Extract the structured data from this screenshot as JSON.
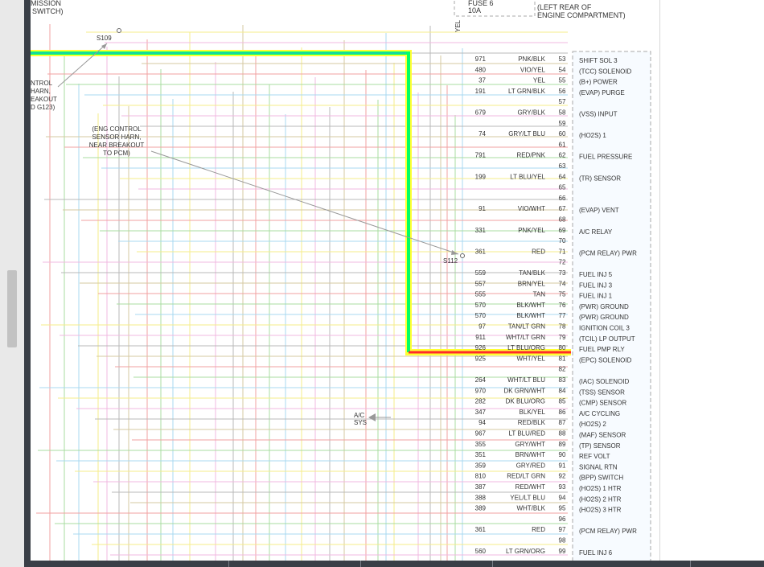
{
  "top_labels": {
    "mission": "MISSION",
    "switch": "SWITCH)",
    "fuse": "FUSE 6",
    "amps": "10A",
    "left_rear": "(LEFT REAR OF",
    "engine_comp": "ENGINE COMPARTMENT)",
    "yel": "YEL"
  },
  "splices": {
    "s109": "S109",
    "s112": "S112"
  },
  "note_left": [
    "NTROL",
    "HARN,",
    "EAKOUT",
    "D G123)"
  ],
  "note_mid": [
    "(ENG CONTROL",
    "SENSOR HARN,",
    "NEAR BREAKOUT",
    "TO PCM)"
  ],
  "ac_sys": [
    "A/C",
    "SYS"
  ],
  "pins": [
    {
      "pin": "53",
      "circuit": "971",
      "color": "PNK/BLK",
      "func": "SHIFT SOL 3"
    },
    {
      "pin": "54",
      "circuit": "480",
      "color": "VIO/YEL",
      "func": "(TCC) SOLENOID"
    },
    {
      "pin": "55",
      "circuit": "37",
      "color": "YEL",
      "func": "(B+) POWER"
    },
    {
      "pin": "56",
      "circuit": "191",
      "color": "LT GRN/BLK",
      "func": "(EVAP) PURGE"
    },
    {
      "pin": "57",
      "circuit": "",
      "color": "",
      "func": ""
    },
    {
      "pin": "58",
      "circuit": "679",
      "color": "GRY/BLK",
      "func": "(VSS) INPUT"
    },
    {
      "pin": "59",
      "circuit": "",
      "color": "",
      "func": ""
    },
    {
      "pin": "60",
      "circuit": "74",
      "color": "GRY/LT BLU",
      "func": "(HO2S) 1"
    },
    {
      "pin": "61",
      "circuit": "",
      "color": "",
      "func": ""
    },
    {
      "pin": "62",
      "circuit": "791",
      "color": "RED/PNK",
      "func": "FUEL PRESSURE"
    },
    {
      "pin": "63",
      "circuit": "",
      "color": "",
      "func": ""
    },
    {
      "pin": "64",
      "circuit": "199",
      "color": "LT BLU/YEL",
      "func": "(TR) SENSOR"
    },
    {
      "pin": "65",
      "circuit": "",
      "color": "",
      "func": ""
    },
    {
      "pin": "66",
      "circuit": "",
      "color": "",
      "func": ""
    },
    {
      "pin": "67",
      "circuit": "91",
      "color": "VIO/WHT",
      "func": "(EVAP) VENT"
    },
    {
      "pin": "68",
      "circuit": "",
      "color": "",
      "func": ""
    },
    {
      "pin": "69",
      "circuit": "331",
      "color": "PNK/YEL",
      "func": "A/C RELAY"
    },
    {
      "pin": "70",
      "circuit": "",
      "color": "",
      "func": ""
    },
    {
      "pin": "71",
      "circuit": "361",
      "color": "RED",
      "func": "(PCM RELAY) PWR"
    },
    {
      "pin": "72",
      "circuit": "",
      "color": "",
      "func": ""
    },
    {
      "pin": "73",
      "circuit": "559",
      "color": "TAN/BLK",
      "func": "FUEL INJ 5"
    },
    {
      "pin": "74",
      "circuit": "557",
      "color": "BRN/YEL",
      "func": "FUEL INJ 3"
    },
    {
      "pin": "75",
      "circuit": "555",
      "color": "TAN",
      "func": "FUEL INJ 1"
    },
    {
      "pin": "76",
      "circuit": "570",
      "color": "BLK/WHT",
      "func": "(PWR) GROUND"
    },
    {
      "pin": "77",
      "circuit": "570",
      "color": "BLK/WHT",
      "func": "(PWR) GROUND"
    },
    {
      "pin": "78",
      "circuit": "97",
      "color": "TAN/LT GRN",
      "func": "IGNITION COIL 3"
    },
    {
      "pin": "79",
      "circuit": "911",
      "color": "WHT/LT GRN",
      "func": "(TCIL) LP OUTPUT"
    },
    {
      "pin": "80",
      "circuit": "926",
      "color": "LT BLU/ORG",
      "func": "FUEL PMP RLY"
    },
    {
      "pin": "81",
      "circuit": "925",
      "color": "WHT/YEL",
      "func": "(EPC) SOLENOID"
    },
    {
      "pin": "82",
      "circuit": "",
      "color": "",
      "func": ""
    },
    {
      "pin": "83",
      "circuit": "264",
      "color": "WHT/LT BLU",
      "func": "(IAC) SOLENOID"
    },
    {
      "pin": "84",
      "circuit": "970",
      "color": "DK GRN/WHT",
      "func": "(TSS) SENSOR"
    },
    {
      "pin": "85",
      "circuit": "282",
      "color": "DK BLU/ORG",
      "func": "(CMP) SENSOR"
    },
    {
      "pin": "86",
      "circuit": "347",
      "color": "BLK/YEL",
      "func": "A/C CYCLING"
    },
    {
      "pin": "87",
      "circuit": "94",
      "color": "RED/BLK",
      "func": "(HO2S) 2"
    },
    {
      "pin": "88",
      "circuit": "967",
      "color": "LT BLU/RED",
      "func": "(MAF) SENSOR"
    },
    {
      "pin": "89",
      "circuit": "355",
      "color": "GRY/WHT",
      "func": "(TP) SENSOR"
    },
    {
      "pin": "90",
      "circuit": "351",
      "color": "BRN/WHT",
      "func": "REF VOLT"
    },
    {
      "pin": "91",
      "circuit": "359",
      "color": "GRY/RED",
      "func": "SIGNAL RTN"
    },
    {
      "pin": "92",
      "circuit": "810",
      "color": "RED/LT GRN",
      "func": "(BPP) SWITCH"
    },
    {
      "pin": "93",
      "circuit": "387",
      "color": "RED/WHT",
      "func": "(HO2S) 1 HTR"
    },
    {
      "pin": "94",
      "circuit": "388",
      "color": "YEL/LT BLU",
      "func": "(HO2S) 2 HTR"
    },
    {
      "pin": "95",
      "circuit": "389",
      "color": "WHT/BLK",
      "func": "(HO2S) 3 HTR"
    },
    {
      "pin": "96",
      "circuit": "",
      "color": "",
      "func": ""
    },
    {
      "pin": "97",
      "circuit": "361",
      "color": "RED",
      "func": "(PCM RELAY) PWR"
    },
    {
      "pin": "98",
      "circuit": "",
      "color": "",
      "func": ""
    },
    {
      "pin": "99",
      "circuit": "560",
      "color": "LT GRN/ORG",
      "func": "FUEL INJ 6"
    }
  ],
  "colors": {
    "highlight_green": "#00ff66",
    "highlight_yellow": "#ffff33",
    "highlight_red": "#ff2a2a",
    "wire_red": "#f2a0a0",
    "wire_green": "#a8dca0",
    "wire_blue": "#a8d8f0",
    "wire_yellow": "#f5ec8a",
    "wire_pink": "#f0b8e0",
    "wire_gray": "#b8b8b8",
    "wire_tan": "#d6c8a0",
    "chrome_dark": "#3a3f47"
  }
}
